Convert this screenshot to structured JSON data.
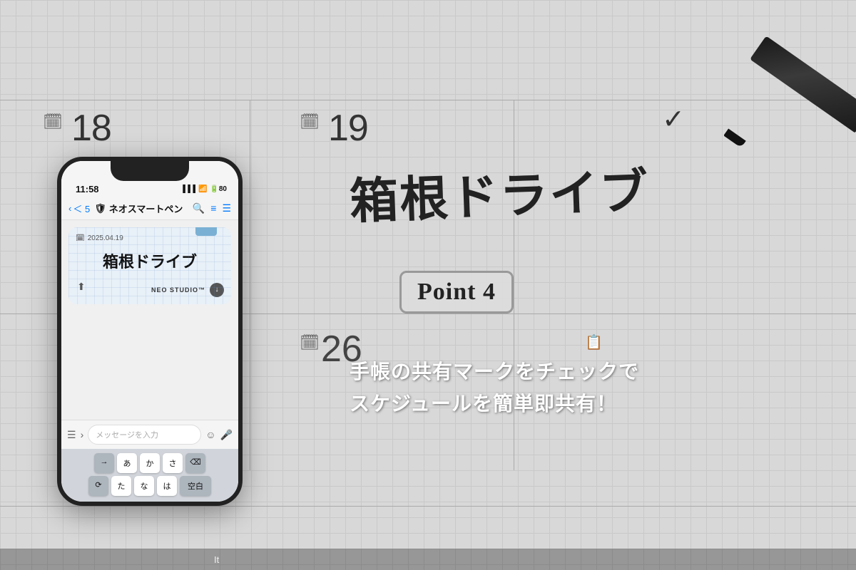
{
  "background": {
    "color": "#c8c8c8"
  },
  "calendar": {
    "date18": "18",
    "date19": "19",
    "date26": "26",
    "handwritten": "箱根ドライブ",
    "checkmark": "✓"
  },
  "point_badge": {
    "label": "Point 4"
  },
  "description": {
    "line1": "手帳の共有マークをチェックで",
    "line2": "スケジュールを簡単即共有！"
  },
  "phone": {
    "status_time": "11:58",
    "status_signal": "▐▐▐",
    "status_wifi": "WiFi",
    "status_battery": "80",
    "nav_back_count": "＜ 5",
    "nav_title": "ネオスマートペン",
    "nav_icon_search": "🔍",
    "nav_icon_list": "☰",
    "note_date": "2025.04.19",
    "note_text": "箱根ドライブ",
    "neo_label": "NEO STUDIO™",
    "message_placeholder": "メッセージを入力",
    "keyboard": {
      "row1": [
        "→",
        "あ",
        "か",
        "さ",
        "⌫"
      ],
      "row2": [
        "⟳",
        "た",
        "な",
        "は",
        "空白"
      ]
    }
  },
  "bottom_text": {
    "label": "It"
  }
}
